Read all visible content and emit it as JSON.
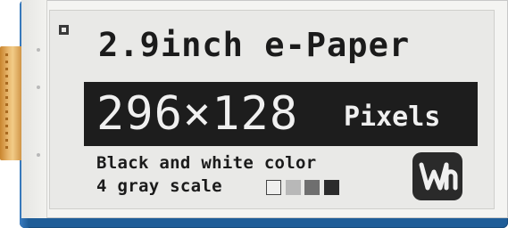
{
  "display": {
    "title": "2.9inch e-Paper",
    "resolution": "296×128",
    "resolution_unit": "Pixels",
    "color_line": "Black and white color",
    "gray_line": "4 gray scale",
    "gray_swatches": [
      "#efefee",
      "#b8b8b8",
      "#6f6f6f",
      "#2b2b2b"
    ],
    "logo_icon": "waveshare-logo-icon"
  },
  "colors": {
    "pcb": "#1f5d98",
    "panel": "#e9e9e7",
    "ink": "#1b1b1b",
    "cable": "#e8b66d"
  }
}
